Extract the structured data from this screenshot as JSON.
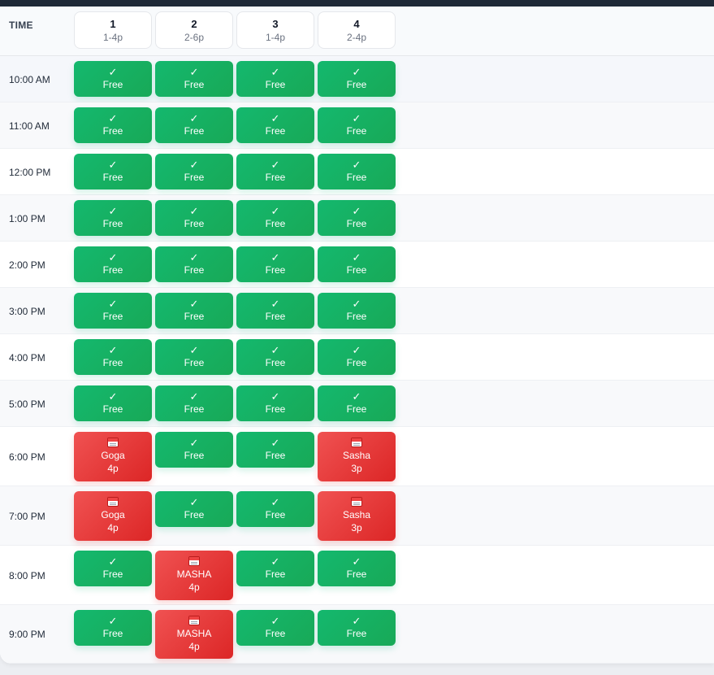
{
  "header": {
    "time_label": "TIME",
    "columns": [
      {
        "number": "1",
        "subtitle": "1-4p"
      },
      {
        "number": "2",
        "subtitle": "2-6p"
      },
      {
        "number": "3",
        "subtitle": "1-4p"
      },
      {
        "number": "4",
        "subtitle": "2-4p"
      }
    ]
  },
  "labels": {
    "free_mark": "✓",
    "free_text": "Free"
  },
  "colors": {
    "free": "#16a34a",
    "booked": "#dc2626"
  },
  "rows": [
    {
      "time": "10:00 AM",
      "cells": [
        {
          "status": "free"
        },
        {
          "status": "free"
        },
        {
          "status": "free"
        },
        {
          "status": "free"
        }
      ]
    },
    {
      "time": "11:00 AM",
      "cells": [
        {
          "status": "free"
        },
        {
          "status": "free"
        },
        {
          "status": "free"
        },
        {
          "status": "free"
        }
      ]
    },
    {
      "time": "12:00 PM",
      "cells": [
        {
          "status": "free"
        },
        {
          "status": "free"
        },
        {
          "status": "free"
        },
        {
          "status": "free"
        }
      ]
    },
    {
      "time": "1:00 PM",
      "cells": [
        {
          "status": "free"
        },
        {
          "status": "free"
        },
        {
          "status": "free"
        },
        {
          "status": "free"
        }
      ]
    },
    {
      "time": "2:00 PM",
      "cells": [
        {
          "status": "free"
        },
        {
          "status": "free"
        },
        {
          "status": "free"
        },
        {
          "status": "free"
        }
      ]
    },
    {
      "time": "3:00 PM",
      "cells": [
        {
          "status": "free"
        },
        {
          "status": "free"
        },
        {
          "status": "free"
        },
        {
          "status": "free"
        }
      ]
    },
    {
      "time": "4:00 PM",
      "cells": [
        {
          "status": "free"
        },
        {
          "status": "free"
        },
        {
          "status": "free"
        },
        {
          "status": "free"
        }
      ]
    },
    {
      "time": "5:00 PM",
      "cells": [
        {
          "status": "free"
        },
        {
          "status": "free"
        },
        {
          "status": "free"
        },
        {
          "status": "free"
        }
      ]
    },
    {
      "time": "6:00 PM",
      "cells": [
        {
          "status": "booked",
          "name": "Goga",
          "size": "4p"
        },
        {
          "status": "free"
        },
        {
          "status": "free"
        },
        {
          "status": "booked",
          "name": "Sasha",
          "size": "3p"
        }
      ]
    },
    {
      "time": "7:00 PM",
      "cells": [
        {
          "status": "booked",
          "name": "Goga",
          "size": "4p"
        },
        {
          "status": "free"
        },
        {
          "status": "free"
        },
        {
          "status": "booked",
          "name": "Sasha",
          "size": "3p"
        }
      ]
    },
    {
      "time": "8:00 PM",
      "cells": [
        {
          "status": "free"
        },
        {
          "status": "booked",
          "name": "MASHA",
          "size": "4p"
        },
        {
          "status": "free"
        },
        {
          "status": "free"
        }
      ]
    },
    {
      "time": "9:00 PM",
      "cells": [
        {
          "status": "free"
        },
        {
          "status": "booked",
          "name": "MASHA",
          "size": "4p"
        },
        {
          "status": "free"
        },
        {
          "status": "free"
        }
      ]
    }
  ]
}
